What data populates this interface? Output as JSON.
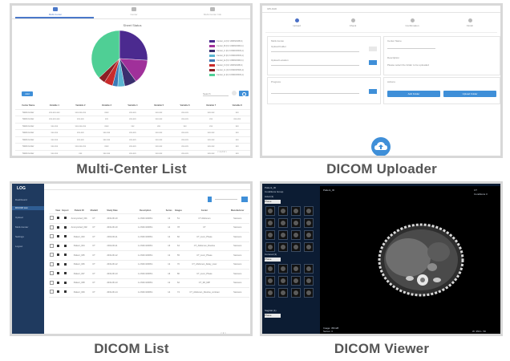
{
  "captions": {
    "multi_center": "Multi-Center List",
    "uploader": "DICOM Uploader",
    "list": "DICOM List",
    "viewer": "DICOM Viewer"
  },
  "multi_center": {
    "tabs": [
      "Multi-Center",
      "Center",
      "Multi-Center Info"
    ],
    "chart_title": "Sheet Status",
    "chart_data": {
      "type": "pie",
      "values": [
        26,
        14,
        7,
        4,
        3,
        5,
        4,
        37
      ],
      "colors": [
        "#4b2a8f",
        "#a0309a",
        "#3a2e6e",
        "#5bb5d1",
        "#3b79b6",
        "#c92b2b",
        "#8c1f25",
        "#4fcf95"
      ]
    },
    "legend": [
      "Center_A (0,0 UNKNOWN,1)",
      "Center_B (0,0 UNKNOWN,1)",
      "Center_C (0,0 UNKNOWN,1)",
      "Center_D (0,0 UNKNOWN,1)",
      "Center_E (0,0 UNKNOWN,1)",
      "Center_F (0,0 UNKNOWN,1)",
      "Center_G (0,0 UNKNOWN,1)",
      "Center_H (0,0 UNKNOWN,1)"
    ],
    "add_button": "Add",
    "search_placeholder": "Search",
    "table_headers": [
      "Center Name",
      "Variable 1",
      "Variable 2",
      "Variable 3",
      "Variable 4",
      "Variable 5",
      "Variable 6",
      "Variable 7",
      "Variable 8"
    ],
    "table_rows": [
      [
        "Multi-Center",
        "xxx-xxx-xxx",
        "xxx-xxx-xxx",
        "xxxx",
        "xxx-xxx",
        "xxx-xxx",
        "xxx-xxx",
        "xxx-xxx",
        "xxx"
      ],
      [
        "Multi-Center",
        "xxx-xxx-xxx",
        "xxx-xxx",
        "xxx",
        "xxx-xxx",
        "xxx-xxx",
        "xxx-xxx",
        "xxx",
        "xxx-xxx"
      ],
      [
        "Multi-Center",
        "xxx-xxx",
        "xxx-xxx-xxx",
        "xxxx",
        "xxx",
        "xxx",
        "xxx",
        "xxx",
        "xxx"
      ],
      [
        "Multi-Center",
        "xxx-xxx",
        "xxx-xxx",
        "xxx-xxx",
        "xxx-xxx",
        "xxx-xxx",
        "xxx-xxx",
        "xxx-xxx",
        "xxx"
      ],
      [
        "Multi-Center",
        "xxx-xxx",
        "xxx-xxx",
        "xxx-xxx",
        "xxx-xxx",
        "xxx-xxx",
        "xxx-xxx",
        "xxx-xxx",
        "xxx"
      ],
      [
        "Multi-Center",
        "xxx-xxx",
        "xxx-xxx-xxx",
        "xxxx",
        "xxx-xxx",
        "xxx-xxx",
        "xxx-xxx",
        "xxx-xxx",
        "xxx"
      ],
      [
        "Multi-Center",
        "xxx-xxx",
        "xxx",
        "xxx-xxx",
        "xxx-xxx",
        "xxx-xxx",
        "xxx-xxx",
        "xxx-xxx",
        "xxx"
      ]
    ]
  },
  "uploader": {
    "header": "UPLOAD",
    "steps": [
      "Upload",
      "Check",
      "Confirmation",
      "Finish"
    ],
    "left_labels": [
      "Multi-Center",
      "Upload Folder",
      "Upload Location",
      "Progress"
    ],
    "right_labels": [
      "Center Name",
      "Description",
      "Actions"
    ],
    "desc_text": "Please select the folder to be uploaded",
    "btn_add": "Add Folder",
    "btn_upload": "Upload Folder"
  },
  "dicom_list": {
    "logo": "LOG",
    "sidebar": [
      "Dashboard",
      "DICOM List",
      "Upload",
      "Multi-Center",
      "Settings",
      "Logout"
    ],
    "headers": [
      "",
      "View",
      "Export",
      "Patient ID",
      "Modality",
      "Study Date",
      "Description",
      "Series",
      "Images",
      "Center",
      "Manufacturer"
    ],
    "rows": [
      [
        "Anonymized_001",
        "CT",
        "2019-06-10",
        "1.2.840.10008.1",
        "12",
        "51",
        "CT Abdomen",
        "Siemens"
      ],
      [
        "Anonymized_002",
        "CT",
        "2019-06-10",
        "1.2.840.10008.1",
        "14",
        "78",
        "CT",
        "Siemens"
      ],
      [
        "Patient_003",
        "CT",
        "2019-06-11",
        "1.2.840.10008.1",
        "12",
        "60",
        "CT_Liver_Phase",
        "Siemens"
      ],
      [
        "Patient_004",
        "CT",
        "2019-06-11",
        "1.2.840.10008.1",
        "16",
        "64",
        "CT_Abdomen_Routine",
        "Siemens"
      ],
      [
        "Patient_005",
        "CT",
        "2019-06-12",
        "1.2.840.10008.1",
        "12",
        "55",
        "CT_Liver_Phase",
        "Siemens"
      ],
      [
        "Patient_006",
        "CT",
        "2019-06-12",
        "1.2.840.10008.1",
        "12",
        "70",
        "CT_Abdomen_Delay_Liver",
        "Siemens"
      ],
      [
        "Patient_007",
        "CT",
        "2019-06-13",
        "1.2.840.10008.1",
        "16",
        "80",
        "CT_Liver_Phase",
        "Siemens"
      ],
      [
        "Patient_008",
        "CT",
        "2019-06-13",
        "1.2.840.10008.1",
        "12",
        "62",
        "CT_3D_MIP",
        "Siemens"
      ],
      [
        "Patient_009",
        "CT",
        "2019-06-14",
        "1.2.840.10008.1",
        "14",
        "74",
        "CT_Abdomen_Routine_contrast",
        "Siemens"
      ]
    ]
  },
  "viewer": {
    "patient": "Patient_ID",
    "conditions": "Conditions Group",
    "axial": "Axial (3)",
    "coronal": "Coronal (3)",
    "sagittal": "Sagittal (1)",
    "select": "Phase",
    "bottom_left": [
      "Image: 35/128",
      "Series: 3",
      "Thick: 5.0 mm"
    ],
    "bottom_right": [
      "W: 350 L: 50",
      "Zoom: 1.00"
    ],
    "top_right": [
      "CT",
      "Conditions 3"
    ]
  }
}
